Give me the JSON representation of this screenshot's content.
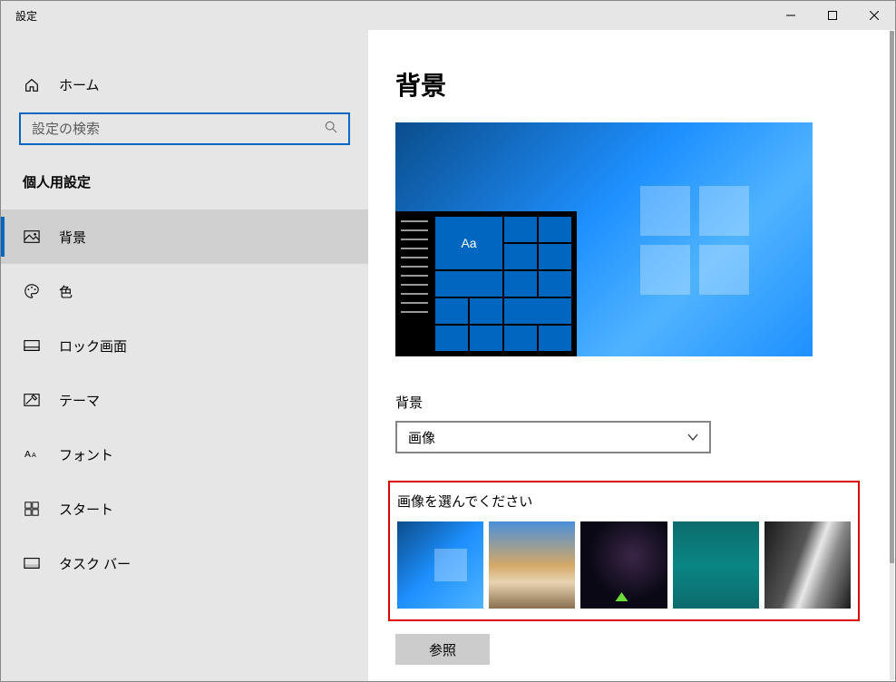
{
  "window": {
    "title": "設定"
  },
  "home_label": "ホーム",
  "search": {
    "placeholder": "設定の検索"
  },
  "category": "個人用設定",
  "nav": [
    {
      "label": "背景",
      "icon": "picture"
    },
    {
      "label": "色",
      "icon": "palette"
    },
    {
      "label": "ロック画面",
      "icon": "lock-screen"
    },
    {
      "label": "テーマ",
      "icon": "theme"
    },
    {
      "label": "フォント",
      "icon": "font"
    },
    {
      "label": "スタート",
      "icon": "start"
    },
    {
      "label": "タスク バー",
      "icon": "taskbar"
    }
  ],
  "page": {
    "title": "背景",
    "preview_sample_text": "Aa",
    "bg_label": "背景",
    "bg_dropdown_value": "画像",
    "choose_label": "画像を選んでください",
    "browse_label": "参照"
  }
}
